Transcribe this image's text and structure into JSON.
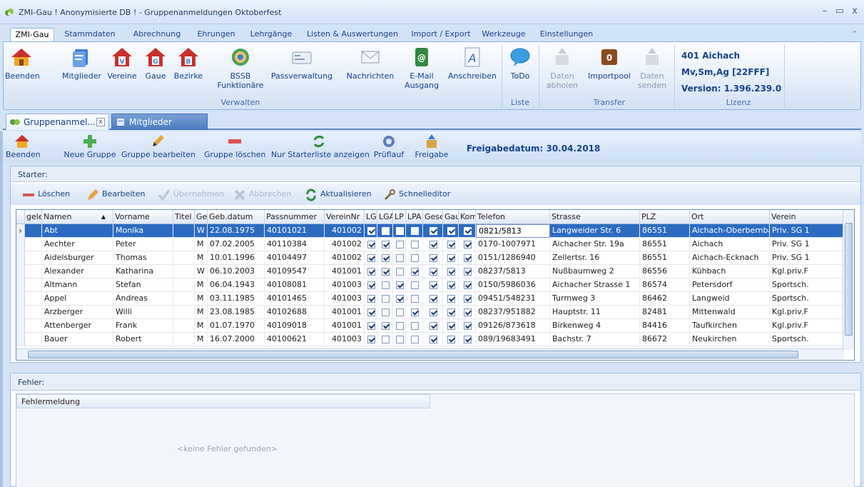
{
  "window": {
    "title": "ZMI-Gau ! Anonymisierte DB ! - Gruppenanmeldungen Oktoberfest",
    "minimize": "–",
    "maximize": "▭",
    "close": "x"
  },
  "menu": [
    "ZMI-Gau",
    "Stammdaten",
    "Abrechnung",
    "Ehrungen",
    "Lehrgänge",
    "Listen & Auswertungen",
    "Import / Export",
    "Werkzeuge",
    "Einstellungen"
  ],
  "ribbon": {
    "buttons": {
      "beenden": "Beenden",
      "mitglieder": "Mitglieder",
      "vereine": "Vereine",
      "gaue": "Gaue",
      "bezirke": "Bezirke",
      "bssb_line1": "BSSB",
      "bssb_line2": "Funktionäre",
      "passverwaltung": "Passverwaltung",
      "nachrichten": "Nachrichten",
      "email_line1": "E-Mail",
      "email_line2": "Ausgang",
      "anschreiben": "Anschreiben",
      "todo": "ToDo",
      "datenabholen_line1": "Daten",
      "datenabholen_line2": "abholen",
      "importpool": "Importpool",
      "datensenden_line1": "Daten",
      "datensenden_line2": "senden"
    },
    "groups": {
      "verwalten": "Verwalten",
      "liste": "Liste",
      "transfer": "Transfer",
      "lizenz": "Lizenz"
    },
    "lizenz": {
      "line1": "401 Aichach",
      "line2": "Mv,Sm,Ag [22FFF]",
      "line3": "Version: 1.396.239.0"
    }
  },
  "doctabs": {
    "tab1": "Gruppenanmel...",
    "tab1_close": "x",
    "tab2": "Mitglieder"
  },
  "toolbar": {
    "beenden": "Beenden",
    "neue_gruppe": "Neue Gruppe",
    "gruppe_bearbeiten": "Gruppe bearbeiten",
    "gruppe_loeschen": "Gruppe löschen",
    "nur_starterliste": "Nur Starterliste anzeigen",
    "prueflauf": "Prüflauf",
    "freigabe": "Freigabe",
    "freigabedatum": "Freigabedatum: 30.04.2018"
  },
  "starter": {
    "title": "Starter:",
    "actions": {
      "loeschen": "Löschen",
      "bearbeiten": "Bearbeiten",
      "uebernehmen": "Übernehmen",
      "abbrechen": "Abbrechen",
      "aktualisieren": "Aktualisieren",
      "schnelleditor": "Schnelleditor"
    },
    "columns": [
      "gele",
      "Namen",
      "Vorname",
      "Titel",
      "Ge",
      "Geb.datum",
      "Passnummer",
      "VereinNr",
      "LG",
      "LGA",
      "LP",
      "LPA",
      "Gese",
      "Gau",
      "Kom",
      "Telefon",
      "Strasse",
      "PLZ",
      "Ort",
      "Verein"
    ],
    "sort_indicator": "▲",
    "rows": [
      {
        "name": "Abt",
        "vorname": "Monika",
        "ge": "W",
        "geb": "22.08.1975",
        "pass": "40101021",
        "verein_nr": "401002",
        "checks": [
          true,
          false,
          false,
          false,
          true,
          true,
          true
        ],
        "tel": "0821/5813",
        "strasse": "Langweider Str. 6",
        "plz": "86551",
        "ort": "Aichach-Oberbernbach",
        "verein": "Priv. SG 1"
      },
      {
        "name": "Aechter",
        "vorname": "Peter",
        "ge": "M",
        "geb": "07.02.2005",
        "pass": "40110384",
        "verein_nr": "401002",
        "checks": [
          true,
          true,
          false,
          false,
          true,
          true,
          true
        ],
        "tel": "0170-1007971",
        "strasse": "Aichacher Str. 19a",
        "plz": "86551",
        "ort": "Aichach",
        "verein": "Priv. SG 1"
      },
      {
        "name": "Aidelsburger",
        "vorname": "Thomas",
        "ge": "M",
        "geb": "10.01.1996",
        "pass": "40104497",
        "verein_nr": "401002",
        "checks": [
          true,
          true,
          false,
          false,
          true,
          true,
          true
        ],
        "tel": "0151/1286940",
        "strasse": "Zellertsr. 16",
        "plz": "86551",
        "ort": "Aichach-Ecknach",
        "verein": "Priv. SG 1"
      },
      {
        "name": "Alexander",
        "vorname": "Katharina",
        "ge": "W",
        "geb": "06.10.2003",
        "pass": "40109547",
        "verein_nr": "401001",
        "checks": [
          true,
          true,
          false,
          true,
          true,
          true,
          true
        ],
        "tel": "08237/5813",
        "strasse": "Nußbaumweg 2",
        "plz": "86556",
        "ort": "Kühbach",
        "verein": "Kgl.priv.F"
      },
      {
        "name": "Altmann",
        "vorname": "Stefan",
        "ge": "M",
        "geb": "06.04.1943",
        "pass": "40108081",
        "verein_nr": "401003",
        "checks": [
          true,
          false,
          true,
          false,
          true,
          true,
          true
        ],
        "tel": "0150/5986036",
        "strasse": "Aichacher Strasse 1",
        "plz": "86574",
        "ort": "Petersdorf",
        "verein": "Sportsch."
      },
      {
        "name": "Appel",
        "vorname": "Andreas",
        "ge": "M",
        "geb": "03.11.1985",
        "pass": "40101465",
        "verein_nr": "401003",
        "checks": [
          true,
          false,
          true,
          false,
          true,
          true,
          true
        ],
        "tel": "09451/548231",
        "strasse": "Turmweg 3",
        "plz": "86462",
        "ort": "Langweid",
        "verein": "Sportsch."
      },
      {
        "name": "Arzberger",
        "vorname": "Willi",
        "ge": "M",
        "geb": "23.08.1985",
        "pass": "40102688",
        "verein_nr": "401001",
        "checks": [
          true,
          false,
          false,
          true,
          true,
          true,
          true
        ],
        "tel": "08237/951882",
        "strasse": "Hauptstr. 11",
        "plz": "82481",
        "ort": "Mittenwald",
        "verein": "Kgl.priv.F"
      },
      {
        "name": "Attenberger",
        "vorname": "Frank",
        "ge": "M",
        "geb": "01.07.1970",
        "pass": "40109018",
        "verein_nr": "401001",
        "checks": [
          true,
          true,
          false,
          false,
          true,
          true,
          true
        ],
        "tel": "09126/873618",
        "strasse": "Birkenweg 4",
        "plz": "84416",
        "ort": "Taufkirchen",
        "verein": "Kgl.priv.F"
      },
      {
        "name": "Bauer",
        "vorname": "Robert",
        "ge": "M",
        "geb": "16.07.2000",
        "pass": "40100621",
        "verein_nr": "401003",
        "checks": [
          true,
          false,
          false,
          false,
          true,
          true,
          true
        ],
        "tel": "089/19683491",
        "strasse": "Bachstr. 7",
        "plz": "86672",
        "ort": "Neukirchen",
        "verein": "Sportsch."
      }
    ]
  },
  "fehler": {
    "title": "Fehler:",
    "column": "Fehlermeldung",
    "empty": "<keine Fehler gefunden>"
  },
  "colors": {
    "accent": "#2c6bc1",
    "ribbon_text": "#15428b",
    "app_bg": "#d4e3f5"
  },
  "icons": [
    "house-icon",
    "members-icon",
    "clubs-icon",
    "gaue-icon",
    "districts-icon",
    "medal-icon",
    "pass-icon",
    "mail-icon",
    "email-icon",
    "letter-icon",
    "speech-bubble-icon",
    "box-icon",
    "plus-icon",
    "pencil-icon",
    "minus-icon",
    "refresh-icon",
    "check-icon",
    "cancel-icon",
    "wrench-icon"
  ]
}
